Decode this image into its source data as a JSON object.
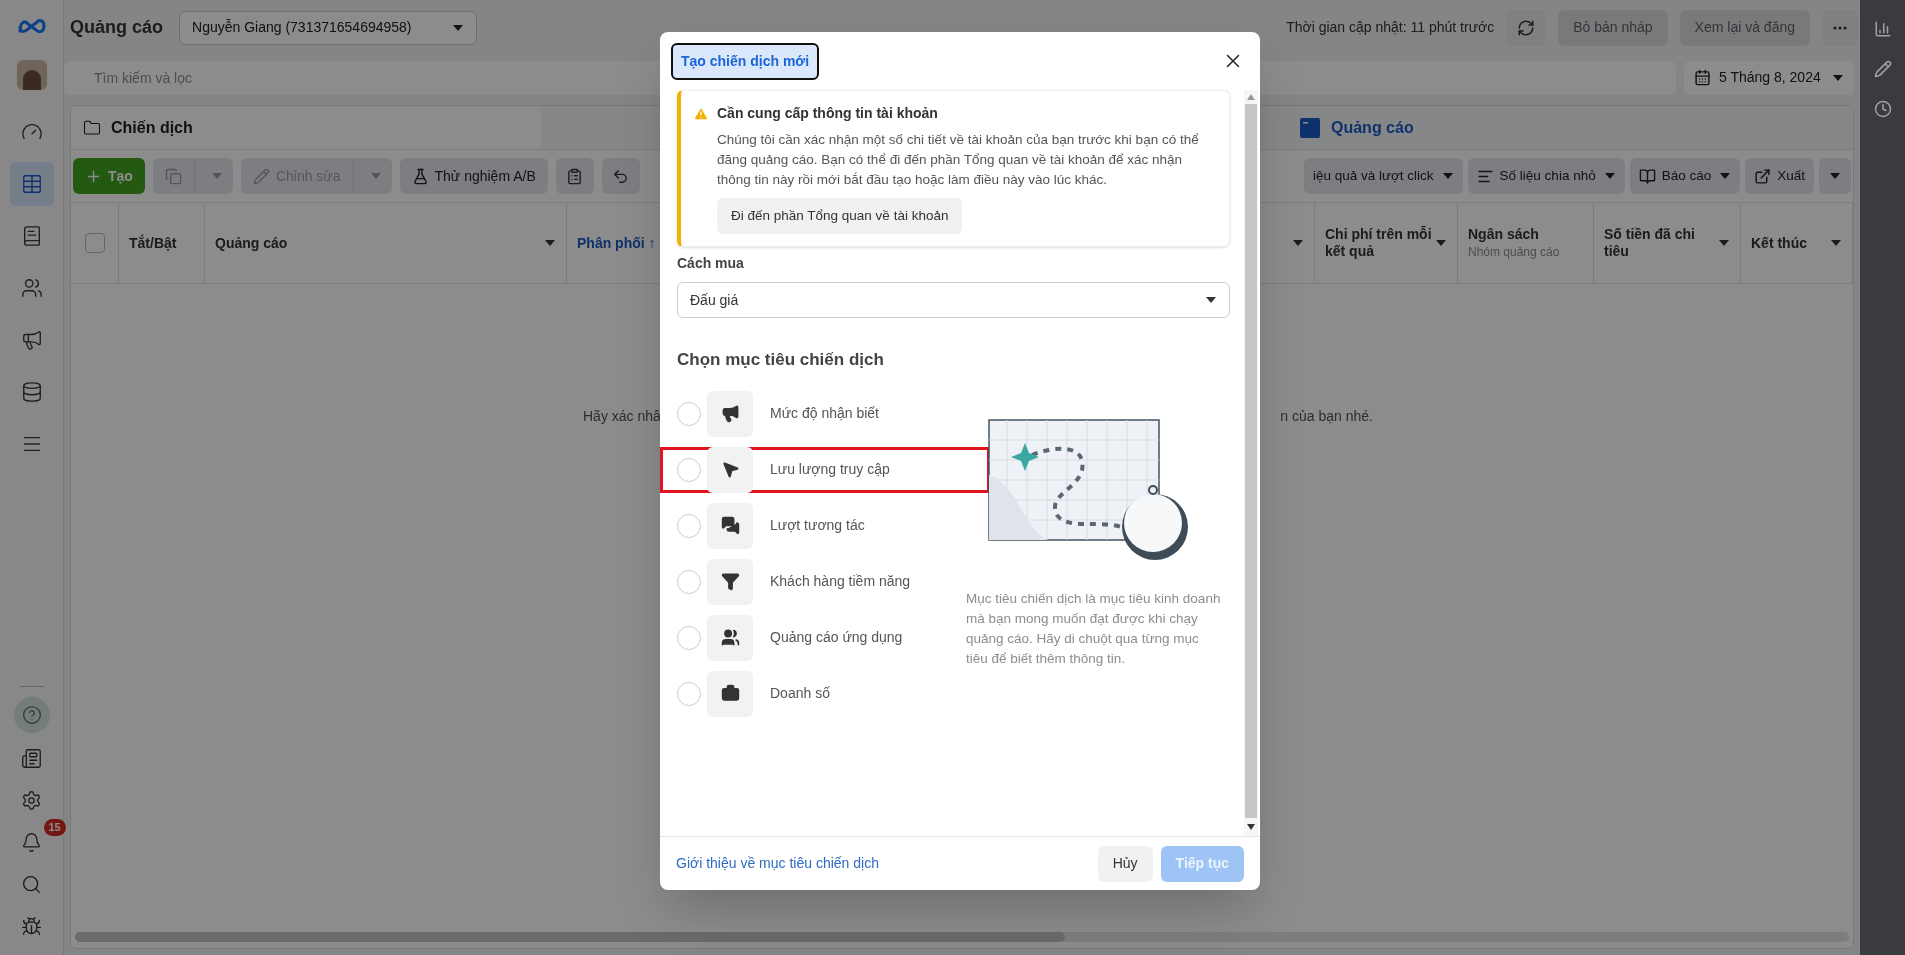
{
  "sidebar": {
    "nav_items": [
      {
        "selected": false
      },
      {
        "selected": true
      },
      {
        "selected": false
      },
      {
        "selected": false
      },
      {
        "selected": false
      },
      {
        "selected": false
      },
      {
        "selected": false
      }
    ],
    "notification_badge": "15"
  },
  "header": {
    "title": "Quảng cáo",
    "account": "Nguyễn Giang (731371654694958)",
    "update_time": "Thời gian cập nhật: 11 phút trước",
    "buttons": [
      {
        "label": "Bỏ bản nháp",
        "disabled": true
      },
      {
        "label": "Xem lại và đăng",
        "disabled": true
      }
    ]
  },
  "search": {
    "placeholder": "Tìm kiếm và lọc"
  },
  "date_range": "5 Tháng 8, 2024",
  "tabs": [
    {
      "label": "Chiến dịch",
      "selected": true
    },
    {
      "label": "Quảng cáo",
      "selected": false
    }
  ],
  "toolbar_left": [
    {
      "kind": "primary",
      "label": "Tạo",
      "disabled": false
    },
    {
      "kind": "split",
      "disabled": true
    },
    {
      "kind": "split",
      "label": "Chỉnh sửa",
      "disabled": true
    },
    {
      "kind": "plain",
      "label": "Thử nghiệm A/B",
      "disabled": false
    },
    {
      "kind": "icon",
      "disabled": false
    },
    {
      "kind": "icon",
      "disabled": false
    }
  ],
  "toolbar_right": [
    {
      "kind": "dropdown",
      "label": "iệu quả và lượt click"
    },
    {
      "kind": "dropdown",
      "label": "Số liệu chia nhỏ"
    },
    {
      "kind": "dropdown",
      "label": "Báo cáo"
    },
    {
      "kind": "plain",
      "label": "Xuất"
    },
    {
      "kind": "caret"
    }
  ],
  "table": {
    "select_all": {
      "checked": false
    },
    "columns_left": [
      {
        "label": "Tắt/Bật",
        "sorted": false,
        "has_menu": false
      },
      {
        "label": "Quảng cáo",
        "sorted": false,
        "has_menu": true
      },
      {
        "label": "Phân phối ↑",
        "sorted": true,
        "has_menu": false
      }
    ],
    "columns_right": [
      {
        "label": "Chi phí trên mỗi kết quả",
        "sorted": false,
        "has_menu": true
      },
      {
        "label": "Ngân sách",
        "sublabel": "Nhóm quảng cáo",
        "sorted": false,
        "has_menu": false
      },
      {
        "label": "Số tiền đã chi tiêu",
        "sorted": false,
        "has_menu": true
      },
      {
        "label": "Kết thúc",
        "sorted": false,
        "has_menu": true
      }
    ],
    "empty_message_parts": [
      "Hãy xác nhâ",
      "n của bạn nhé."
    ]
  },
  "modal": {
    "title": "Tạo chiến dịch mới",
    "notice": {
      "title": "Cần cung cấp thông tin tài khoản",
      "text": "Chúng tôi cần xác nhận một số chi tiết về tài khoản của bạn trước khi bạn có thể đăng quảng cáo. Bạn có thể đi đến phần Tổng quan về tài khoản để xác nhận thông tin này rồi mới bắt đầu tạo hoặc làm điều này vào lúc khác.",
      "button": "Đi đến phần Tổng quan về tài khoản"
    },
    "buying_type": {
      "label": "Cách mua",
      "value": "Đấu giá"
    },
    "objectives_heading": "Chọn mục tiêu chiến dịch",
    "objectives": [
      {
        "label": "Mức độ nhận biết",
        "selected": false,
        "highlighted": false
      },
      {
        "label": "Lưu lượng truy cập",
        "selected": false,
        "highlighted": true
      },
      {
        "label": "Lượt tương tác",
        "selected": false,
        "highlighted": false
      },
      {
        "label": "Khách hàng tiềm năng",
        "selected": false,
        "highlighted": false
      },
      {
        "label": "Quảng cáo ứng dụng",
        "selected": false,
        "highlighted": false
      },
      {
        "label": "Doanh số",
        "selected": false,
        "highlighted": false
      }
    ],
    "description": "Mục tiêu chiến dịch là mục tiêu kinh doanh mà bạn mong muốn đạt được khi chạy quảng cáo. Hãy di chuột qua từng mục tiêu để biết thêm thông tin.",
    "footer_link": "Giới thiệu về mục tiêu chiến dịch",
    "buttons": [
      {
        "label": "Hủy",
        "kind": "secondary",
        "disabled": false
      },
      {
        "label": "Tiếp tục",
        "kind": "primary",
        "disabled": true
      }
    ]
  }
}
